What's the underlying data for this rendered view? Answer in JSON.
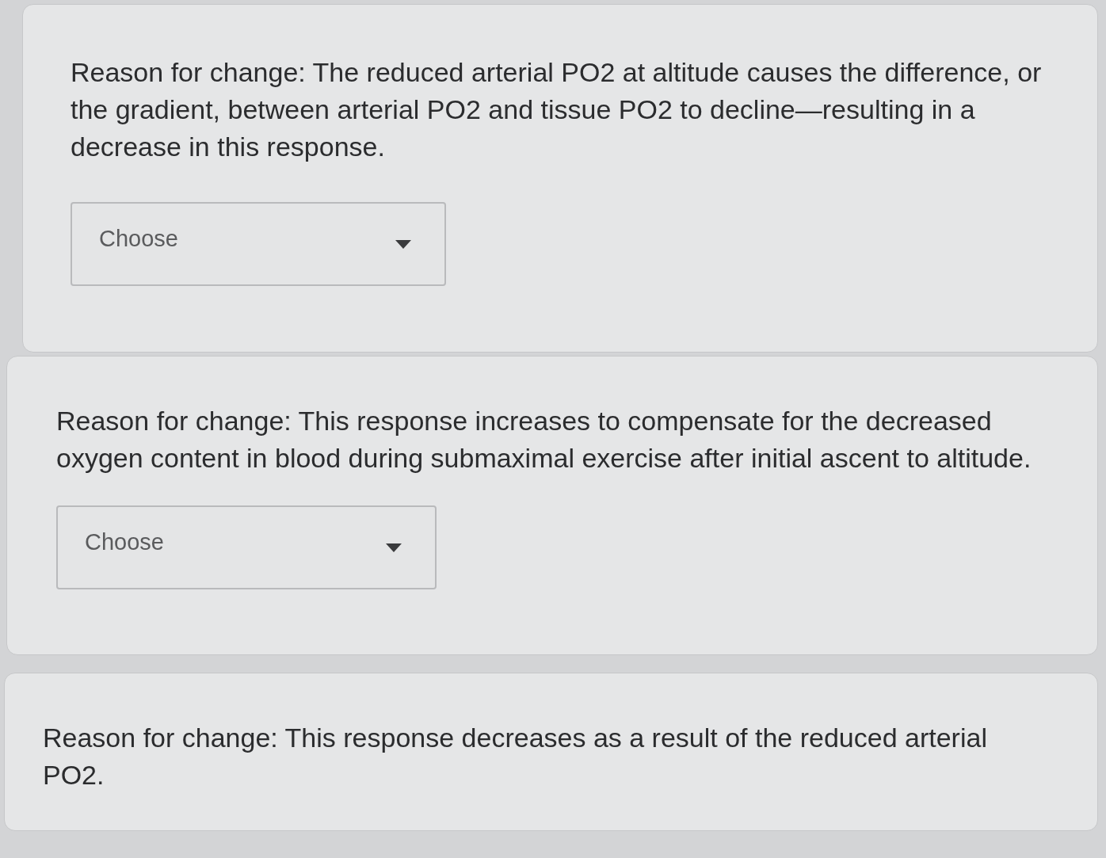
{
  "questions": [
    {
      "prompt": "Reason for change: The reduced arterial PO2 at altitude causes the difference, or the gradient, between arterial PO2 and tissue PO2 to decline—resulting in a decrease in this response.",
      "select": {
        "placeholder": "Choose"
      }
    },
    {
      "prompt": "Reason for change: This response increases to compensate for the decreased oxygen content in blood during submaximal exercise after initial ascent to altitude.",
      "select": {
        "placeholder": "Choose"
      }
    },
    {
      "prompt": "Reason for change: This response decreases as a result of the reduced arterial PO2."
    }
  ]
}
